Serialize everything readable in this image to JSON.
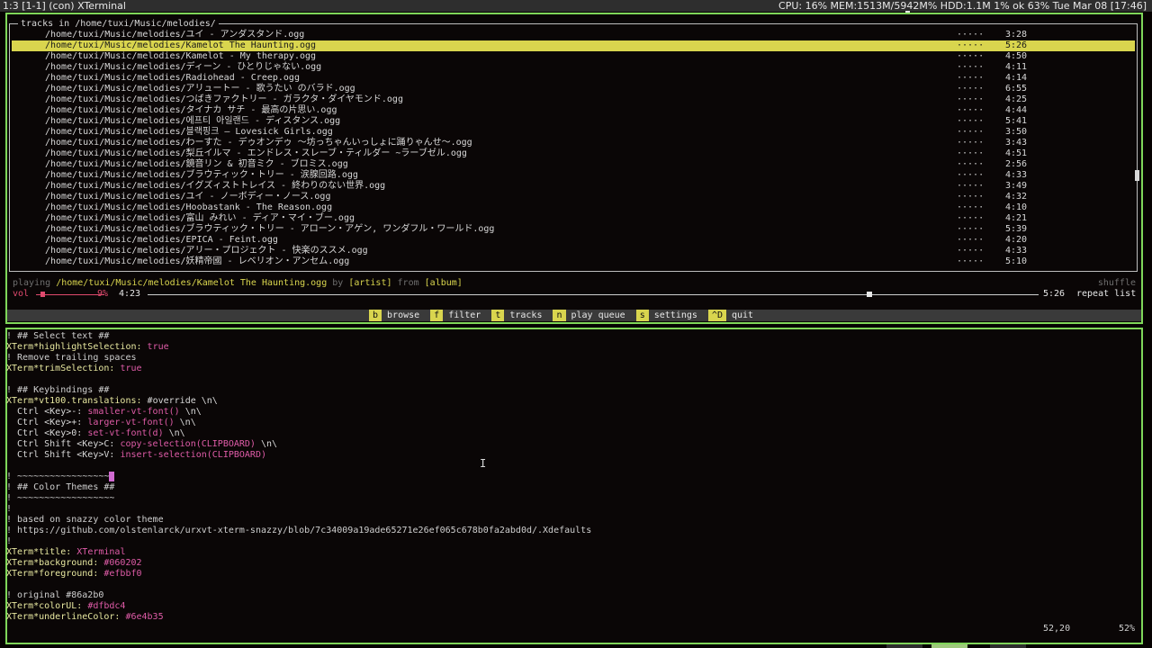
{
  "topbar": {
    "left_text": "1:3 [1-1] (con) XTerminal",
    "right_text": "CPU: 16% MEM:1513M/5942M% HDD:1.1M 1% ok 63%  Tue Mar 08 [17:46]"
  },
  "tracks": {
    "title": "tracks in /home/tuxi/Music/melodies/",
    "items": [
      {
        "path": "/home/tuxi/Music/melodies/ユイ - アンダスタンド.ogg",
        "dots": "·····",
        "duration": "3:28"
      },
      {
        "path": "/home/tuxi/Music/melodies/Kamelot The Haunting.ogg",
        "dots": "·····",
        "duration": "5:26"
      },
      {
        "path": "/home/tuxi/Music/melodies/Kamelot - My therapy.ogg",
        "dots": "·····",
        "duration": "4:50"
      },
      {
        "path": "/home/tuxi/Music/melodies/ディーン - ひとりじゃない.ogg",
        "dots": "·····",
        "duration": "4:11"
      },
      {
        "path": "/home/tuxi/Music/melodies/Radiohead - Creep.ogg",
        "dots": "·····",
        "duration": "4:14"
      },
      {
        "path": "/home/tuxi/Music/melodies/アリュートー - 歌うたい のバラド.ogg",
        "dots": "·····",
        "duration": "6:55"
      },
      {
        "path": "/home/tuxi/Music/melodies/つばきファクトリー - ガラクタ・ダイヤモンド.ogg",
        "dots": "·····",
        "duration": "4:25"
      },
      {
        "path": "/home/tuxi/Music/melodies/タイナカ サチ - 最高の片思い.ogg",
        "dots": "·····",
        "duration": "4:44"
      },
      {
        "path": "/home/tuxi/Music/melodies/에프티 아일랜드 - ディスタンス.ogg",
        "dots": "·····",
        "duration": "5:41"
      },
      {
        "path": "/home/tuxi/Music/melodies/블랙핑크 – Lovesick Girls.ogg",
        "dots": "·····",
        "duration": "3:50"
      },
      {
        "path": "/home/tuxi/Music/melodies/わーすた - デゥオンデゥ 〜坊っちゃんいっしょに踊りゃんせ〜.ogg",
        "dots": "·····",
        "duration": "3:43"
      },
      {
        "path": "/home/tuxi/Music/melodies/梨丘イルマ - エンドレス・スレーブ・ティルダー ~ラーブゼル.ogg",
        "dots": "·····",
        "duration": "4:51"
      },
      {
        "path": "/home/tuxi/Music/melodies/鏡音リン & 初音ミク - ブロミス.ogg",
        "dots": "·····",
        "duration": "2:56"
      },
      {
        "path": "/home/tuxi/Music/melodies/ブラウティック・トリー - 涙腺回路.ogg",
        "dots": "·····",
        "duration": "4:33"
      },
      {
        "path": "/home/tuxi/Music/melodies/イグズィストトレイス - 終わりのない世界.ogg",
        "dots": "·····",
        "duration": "3:49"
      },
      {
        "path": "/home/tuxi/Music/melodies/ユイ - ノーボディー・ノース.ogg",
        "dots": "·····",
        "duration": "4:32"
      },
      {
        "path": "/home/tuxi/Music/melodies/Hoobastank - The Reason.ogg",
        "dots": "·····",
        "duration": "4:10"
      },
      {
        "path": "/home/tuxi/Music/melodies/富山 みれい - ディア・マイ・ブー.ogg",
        "dots": "·····",
        "duration": "4:21"
      },
      {
        "path": "/home/tuxi/Music/melodies/ブラウティック・トリー - アローン・アゲン, ワンダフル・ワールド.ogg",
        "dots": "·····",
        "duration": "5:39"
      },
      {
        "path": "/home/tuxi/Music/melodies/EPICA - Feint.ogg",
        "dots": "·····",
        "duration": "4:20"
      },
      {
        "path": "/home/tuxi/Music/melodies/アリー・プロジェクト - 快楽のススメ.ogg",
        "dots": "·····",
        "duration": "4:33"
      },
      {
        "path": "/home/tuxi/Music/melodies/妖精帝國 - レベリオン・アンセム.ogg",
        "dots": "·····",
        "duration": "5:10"
      }
    ],
    "selected_index": 1
  },
  "player": {
    "playing_label": "playing",
    "track_path": "/home/tuxi/Music/melodies/Kamelot The Haunting.ogg",
    "by_label": "by",
    "artist": "[artist]",
    "from_label": "from",
    "album": "[album]",
    "shuffle_label": "shuffle",
    "vol_label": "vol",
    "vol_percent_text": "9%",
    "volume_fraction": 0.09,
    "elapsed": "4:23",
    "total": "5:26",
    "progress_fraction": 0.81,
    "repeat_label": "repeat list"
  },
  "menu": [
    {
      "key": "b",
      "label": "browse"
    },
    {
      "key": "f",
      "label": "filter"
    },
    {
      "key": "t",
      "label": "tracks"
    },
    {
      "key": "n",
      "label": "play queue"
    },
    {
      "key": "s",
      "label": "settings"
    },
    {
      "key": "^D",
      "label": "quit"
    }
  ],
  "editor": {
    "lines": [
      [
        {
          "t": "! ## Select text ##",
          "c": "com"
        }
      ],
      [
        {
          "t": "XTerm*highlightSelection: ",
          "c": "key"
        },
        {
          "t": "true",
          "c": "val"
        }
      ],
      [
        {
          "t": "! Remove trailing spaces",
          "c": "com"
        }
      ],
      [
        {
          "t": "XTerm*trimSelection: ",
          "c": "key"
        },
        {
          "t": "true",
          "c": "val"
        }
      ],
      [],
      [
        {
          "t": "! ## Keybindings ##",
          "c": "com"
        }
      ],
      [
        {
          "t": "XTerm*vt100.translations: ",
          "c": "key"
        },
        {
          "t": "#override \\n\\",
          "c": "txt"
        }
      ],
      [
        {
          "t": "  Ctrl <Key>-: ",
          "c": "txt"
        },
        {
          "t": "smaller-vt-font()",
          "c": "val"
        },
        {
          "t": " \\n\\",
          "c": "txt"
        }
      ],
      [
        {
          "t": "  Ctrl <Key>+: ",
          "c": "txt"
        },
        {
          "t": "larger-vt-font()",
          "c": "val"
        },
        {
          "t": " \\n\\",
          "c": "txt"
        }
      ],
      [
        {
          "t": "  Ctrl <Key>0: ",
          "c": "txt"
        },
        {
          "t": "set-vt-font(d)",
          "c": "val"
        },
        {
          "t": " \\n\\",
          "c": "txt"
        }
      ],
      [
        {
          "t": "  Ctrl Shift <Key>C: ",
          "c": "txt"
        },
        {
          "t": "copy-selection(CLIPBOARD)",
          "c": "val"
        },
        {
          "t": " \\n\\",
          "c": "txt"
        }
      ],
      [
        {
          "t": "  Ctrl Shift <Key>V: ",
          "c": "txt"
        },
        {
          "t": "insert-selection(CLIPBOARD)",
          "c": "val"
        }
      ],
      [],
      [
        {
          "t": "! ~~~~~~~~~~~~~~~~~",
          "c": "com"
        },
        {
          "cursor": true
        }
      ],
      [
        {
          "t": "! ## Color Themes ##",
          "c": "com"
        }
      ],
      [
        {
          "t": "! ~~~~~~~~~~~~~~~~~~",
          "c": "com"
        }
      ],
      [
        {
          "t": "!",
          "c": "com"
        }
      ],
      [
        {
          "t": "! based on snazzy color theme",
          "c": "com"
        }
      ],
      [
        {
          "t": "! https://github.com/olstenlarck/urxvt-xterm-snazzy/blob/7c34009a19ade65271e26ef065c678b0fa2abd0d/.Xdefaults",
          "c": "com"
        }
      ],
      [
        {
          "t": "!",
          "c": "com"
        }
      ],
      [
        {
          "t": "XTerm*title: ",
          "c": "key"
        },
        {
          "t": "XTerminal",
          "c": "val"
        }
      ],
      [
        {
          "t": "XTerm*background: ",
          "c": "key"
        },
        {
          "t": "#060202",
          "c": "val"
        }
      ],
      [
        {
          "t": "XTerm*foreground: ",
          "c": "key"
        },
        {
          "t": "#efbbf0",
          "c": "val"
        }
      ],
      [],
      [
        {
          "t": "! original #86a2b0",
          "c": "com"
        }
      ],
      [
        {
          "t": "XTerm*colorUL: ",
          "c": "key"
        },
        {
          "t": "#dfbdc4",
          "c": "val"
        }
      ],
      [
        {
          "t": "XTerm*underlineColor: ",
          "c": "key"
        },
        {
          "t": "#6e4b35",
          "c": "val"
        }
      ]
    ],
    "cursor_position": "52,20",
    "scroll_percent": "52%"
  },
  "colors": {
    "frame": "#7fd65a",
    "highlight": "#d9d54e",
    "accent_pink": "#e05ca8"
  }
}
